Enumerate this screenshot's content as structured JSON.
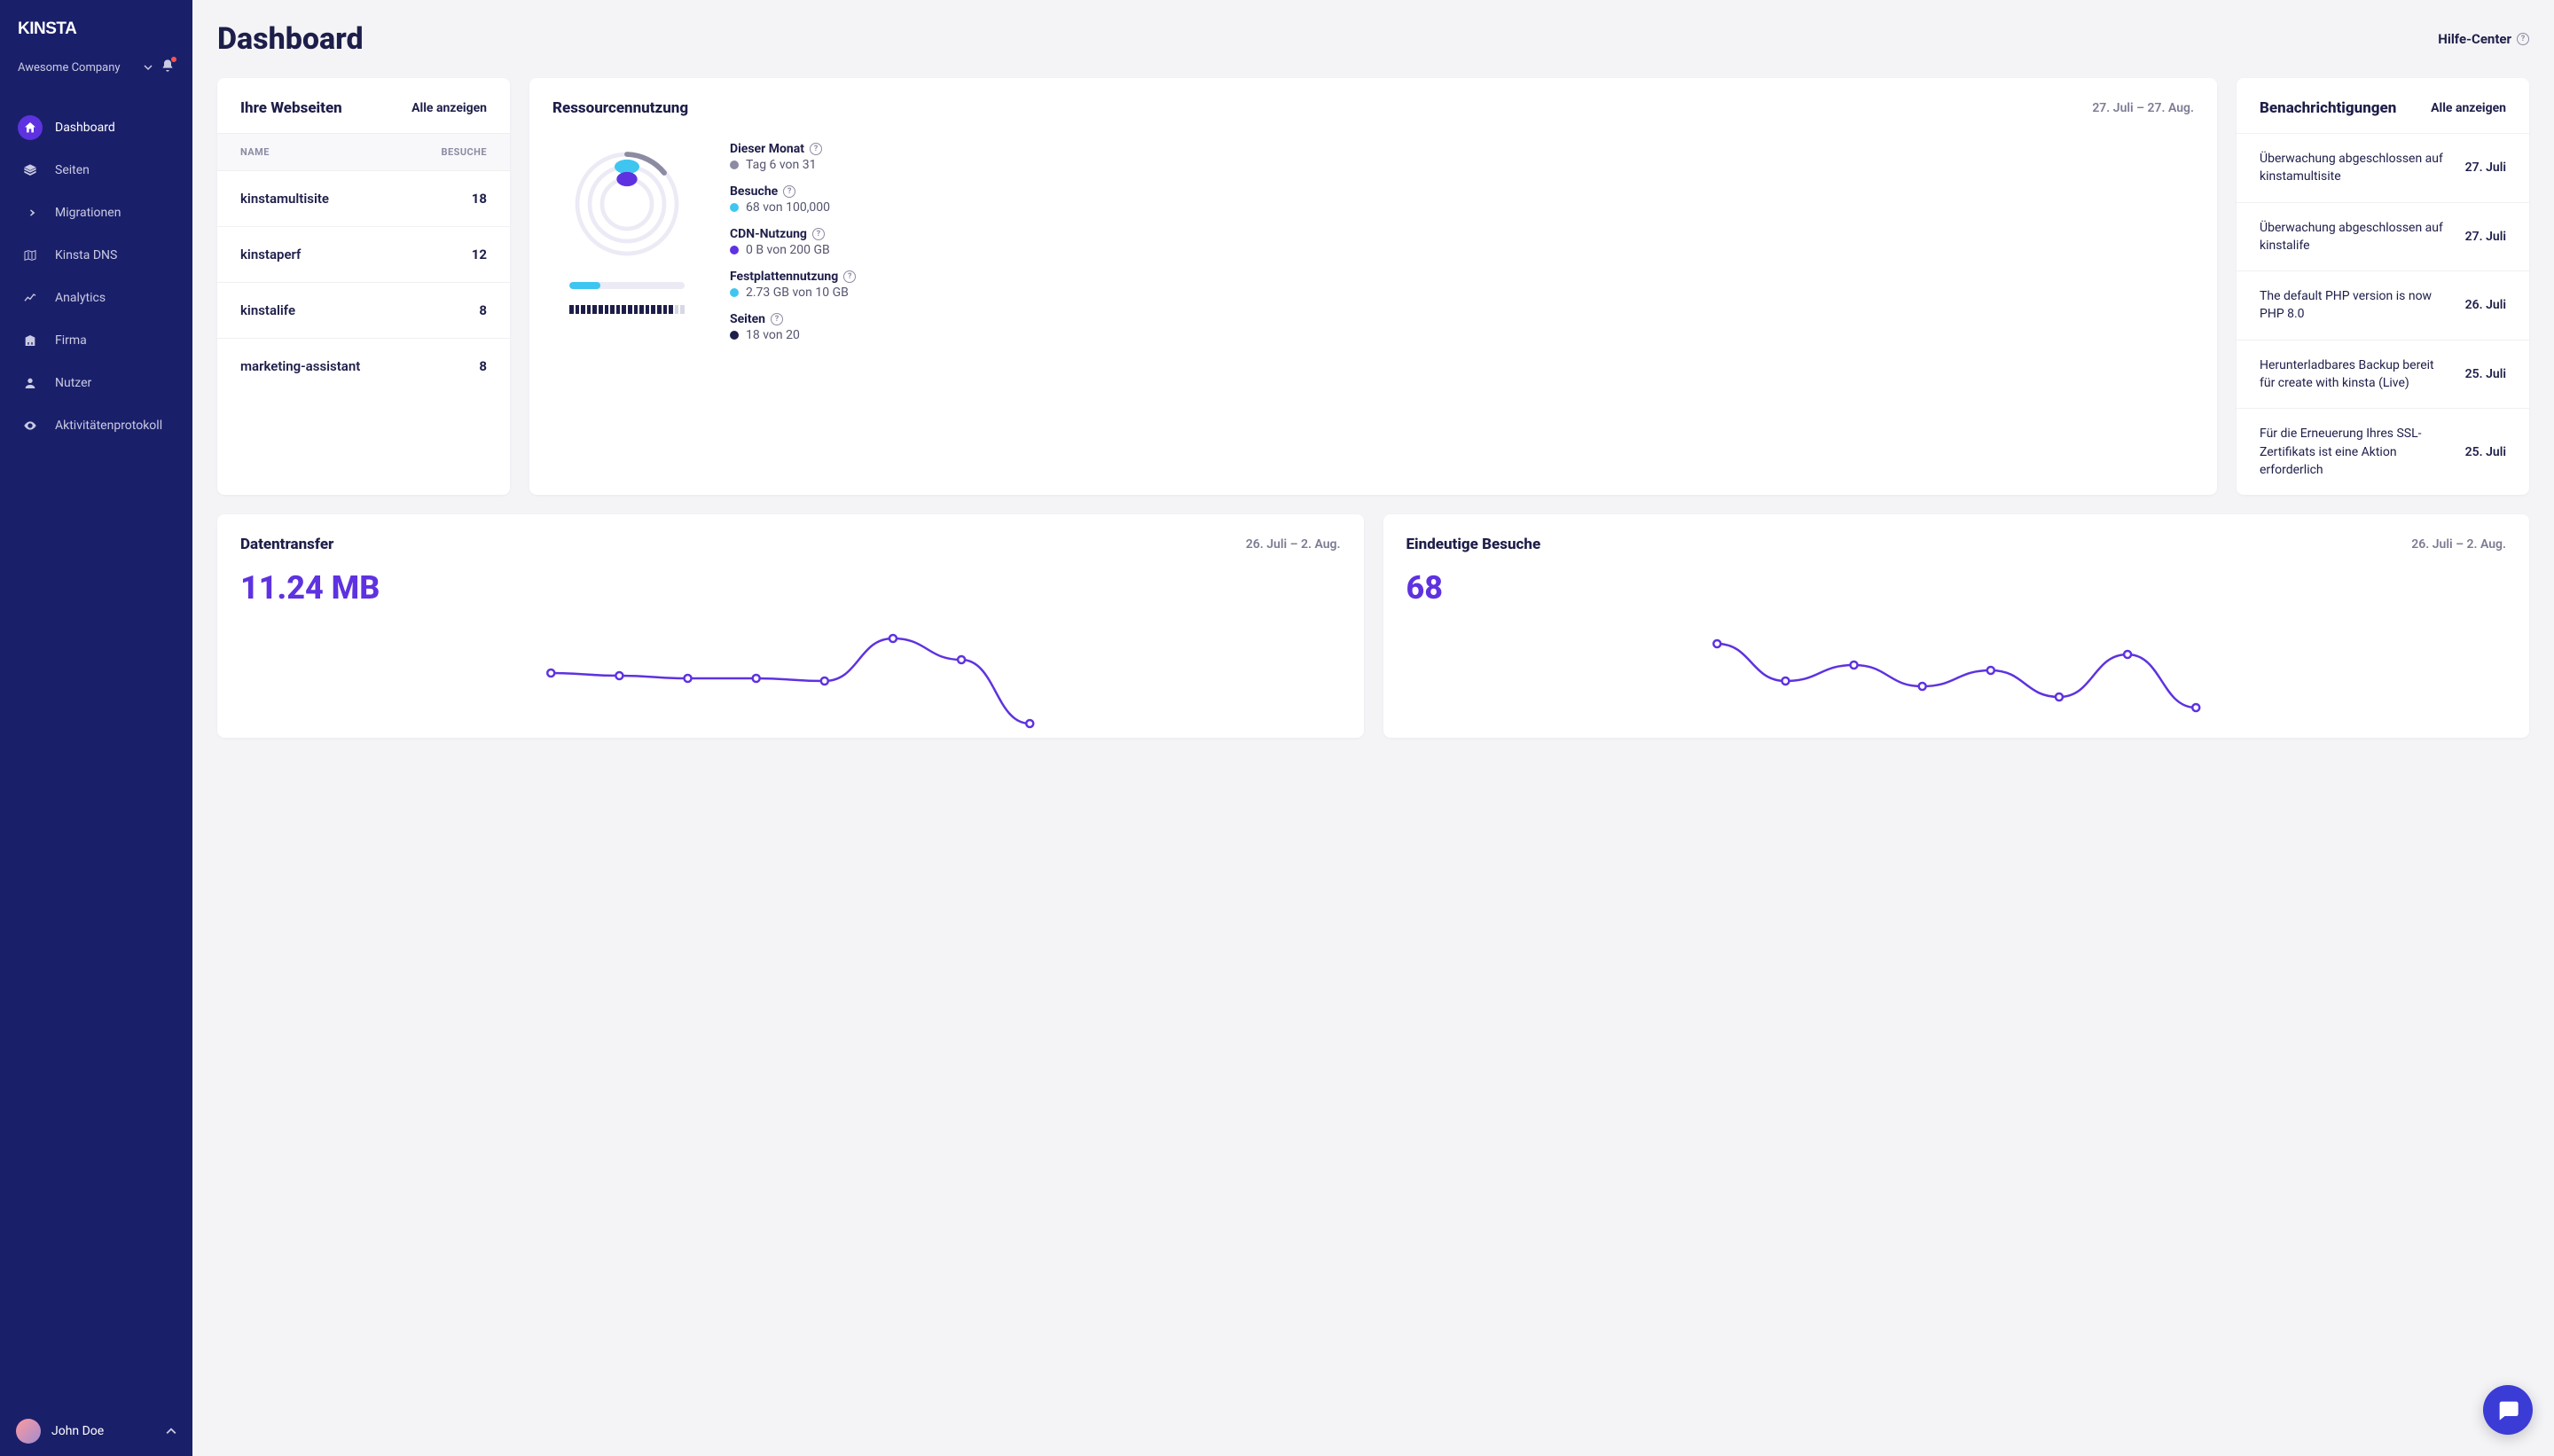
{
  "brand": "kinsta",
  "company": "Awesome Company",
  "user": "John Doe",
  "page_title": "Dashboard",
  "help_link": "Hilfe-Center",
  "nav": [
    {
      "label": "Dashboard",
      "icon": "home"
    },
    {
      "label": "Seiten",
      "icon": "layers"
    },
    {
      "label": "Migrationen",
      "icon": "arrow"
    },
    {
      "label": "Kinsta DNS",
      "icon": "map"
    },
    {
      "label": "Analytics",
      "icon": "trend"
    },
    {
      "label": "Firma",
      "icon": "building"
    },
    {
      "label": "Nutzer",
      "icon": "user"
    },
    {
      "label": "Aktivitätenprotokoll",
      "icon": "eye"
    }
  ],
  "sites_card": {
    "title": "Ihre Webseiten",
    "link": "Alle anzeigen",
    "col_name": "NAME",
    "col_visits": "BESUCHE",
    "rows": [
      {
        "name": "kinstamultisite",
        "visits": "18"
      },
      {
        "name": "kinstaperf",
        "visits": "12"
      },
      {
        "name": "kinstalife",
        "visits": "8"
      },
      {
        "name": "marketing-assistant",
        "visits": "8"
      }
    ]
  },
  "resource_card": {
    "title": "Ressourcennutzung",
    "range": "27. Juli – 27. Aug.",
    "month": {
      "label": "Dieser Monat",
      "value": "Tag 6 von 31",
      "color": "#8b8ba2"
    },
    "visits": {
      "label": "Besuche",
      "value": "68 von 100,000",
      "color": "#3fc6f0"
    },
    "cdn": {
      "label": "CDN-Nutzung",
      "value": "0 B von 200 GB",
      "color": "#5e32e0"
    },
    "disk": {
      "label": "Festplattennutzung",
      "value": "2.73 GB von 10 GB",
      "color": "#3fc6f0"
    },
    "sites": {
      "label": "Seiten",
      "value": "18 von 20",
      "color": "#1e1e4a"
    }
  },
  "notif_card": {
    "title": "Benachrichtigungen",
    "link": "Alle anzeigen",
    "items": [
      {
        "text": "Überwachung abgeschlossen auf kinstamultisite",
        "date": "27. Juli"
      },
      {
        "text": "Überwachung abgeschlossen auf kinstalife",
        "date": "27. Juli"
      },
      {
        "text": "The default PHP version is now PHP 8.0",
        "date": "26. Juli"
      },
      {
        "text": "Herunterladbares Backup bereit für create with kinsta (Live)",
        "date": "25. Juli"
      },
      {
        "text": "Für die Erneuerung Ihres SSL-Zertifikats ist eine Aktion erforderlich",
        "date": "25. Juli"
      }
    ]
  },
  "transfer_card": {
    "title": "Datentransfer",
    "range": "26. Juli – 2. Aug.",
    "value": "11.24 MB"
  },
  "visits_card": {
    "title": "Eindeutige Besuche",
    "range": "26. Juli – 2. Aug.",
    "value": "68"
  },
  "chart_data": [
    {
      "type": "line",
      "title": "Datentransfer",
      "xlabel": "",
      "ylabel": "MB",
      "x": [
        0,
        1,
        2,
        3,
        4,
        5,
        6,
        7
      ],
      "values": [
        4.2,
        4.0,
        3.8,
        3.8,
        3.6,
        6.8,
        5.2,
        0.4
      ],
      "ylim": [
        0,
        8
      ]
    },
    {
      "type": "line",
      "title": "Eindeutige Besuche",
      "xlabel": "",
      "ylabel": "Besuche",
      "x": [
        0,
        1,
        2,
        3,
        4,
        5,
        6,
        7
      ],
      "values": [
        16,
        9,
        12,
        8,
        11,
        6,
        14,
        4
      ],
      "ylim": [
        0,
        20
      ]
    }
  ],
  "colors": {
    "accent": "#5e32e0",
    "cyan": "#3fc6f0",
    "navy": "#1a1f6a"
  }
}
